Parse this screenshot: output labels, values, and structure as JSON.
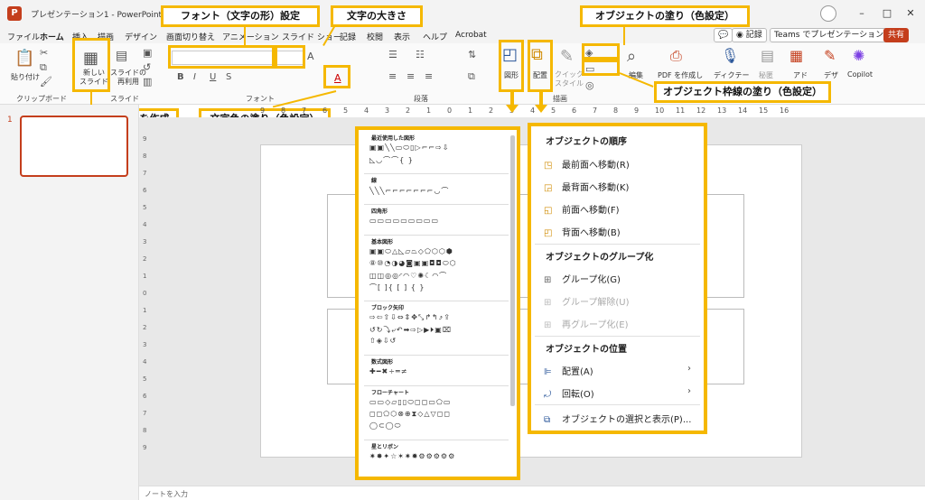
{
  "app": {
    "title": "プレゼンテーション1 - PowerPoint"
  },
  "window_controls": {
    "minimize": "–",
    "maximize": "□",
    "close": "✕"
  },
  "menu_tabs": [
    "ファイル",
    "ホーム",
    "挿入",
    "描画",
    "デザイン",
    "画面切り替え",
    "アニメーション",
    "スライド ショー",
    "記録",
    "校閲",
    "表示",
    "ヘルプ",
    "Acrobat"
  ],
  "ribbon_right": {
    "comment": "💬",
    "record": "◉ 記録",
    "teams": "Teams でプレゼンテーション",
    "share": "共有"
  },
  "ribbon": {
    "paste": "貼り付け",
    "new_slide": "新しい\nスライド",
    "reuse_slide": "スライドの\n再利用",
    "shapes": "図形",
    "arrange": "配置",
    "quick_styles": "クイック\nスタイル",
    "edit": "編集",
    "pdf": "PDF を作成し",
    "dictate": "ディクテー",
    "secret": "秘匿",
    "add": "アド",
    "design": "デザ",
    "copilot": "Copilot"
  },
  "groups": {
    "clipboard": "クリップボード",
    "slide": "スライド",
    "font": "フォント",
    "paragraph": "段落",
    "drawing": "描画"
  },
  "callouts": {
    "font": "フォント（文字の形）設定",
    "size": "文字の大きさ",
    "fill": "オブジェクトの塗り（色設定）",
    "outline": "オブジェクト枠線の塗り（色設定）",
    "new_page": "新しいページを作成",
    "text_color": "文字色の塗り（色設定）"
  },
  "ruler": [
    "9",
    "8",
    "7",
    "6",
    "5",
    "4",
    "3",
    "2",
    "1",
    "0",
    "1",
    "2",
    "3",
    "4",
    "5",
    "6",
    "7",
    "8",
    "9",
    "10",
    "11",
    "12",
    "13",
    "14",
    "15",
    "16"
  ],
  "vruler": [
    "9",
    "8",
    "7",
    "6",
    "5",
    "4",
    "3",
    "2",
    "1",
    "0",
    "1",
    "2",
    "3",
    "4",
    "5",
    "6",
    "7",
    "8",
    "9"
  ],
  "slide_number": "1",
  "notes": "ノートを入力",
  "shapes_panel": {
    "sections": [
      {
        "title": "最近使用した図形",
        "rows": [
          "▣▣╲╲▭⬭▯▷⌐⌐⇨⇩",
          "◺◡⌒⌒{ }"
        ]
      },
      {
        "title": "線",
        "rows": [
          "╲╲╲⌐⌐⌐⌐⌐⌐⌐◡⌒"
        ]
      },
      {
        "title": "四角形",
        "rows": [
          "▭▭▭▭▭▭▭▭▭"
        ]
      },
      {
        "title": "基本図形",
        "rows": [
          "▣▣⬭△◺▱⏢◇⬠⬡⬡⬢",
          "⑧⑩◔◑◕◙▣▣◘◘⬭⬡",
          "◫◫◎◎◜◠♡✺☾◠⌒",
          "⌒[ ]{ [ ] { }"
        ]
      },
      {
        "title": "ブロック矢印",
        "rows": [
          "⇨⇦⇧⇩⇔⇕✥⤡↱↰⤴⇪",
          "↺↻⤵⤶↶➡⇨▷▶⏵▣⌧",
          "⇧◈⇩↺"
        ]
      },
      {
        "title": "数式図形",
        "rows": [
          "✚━✖÷═≠"
        ]
      },
      {
        "title": "フローチャート",
        "rows": [
          "▭▭◇▱▯▯⬭◻◻▭⬠▭",
          "◻◻⬠⬡⊗⊕⧗◇△▽◻◻",
          "◯⊂◯⬭"
        ]
      },
      {
        "title": "星とリボン",
        "rows": [
          "✷✸✦☆✶✷✹⚙⚙⚙⚙⚙"
        ]
      }
    ]
  },
  "arrange_panel": {
    "order_title": "オブジェクトの順序",
    "order_items": [
      "最前面へ移動(R)",
      "最背面へ移動(K)",
      "前面へ移動(F)",
      "背面へ移動(B)"
    ],
    "group_title": "オブジェクトのグループ化",
    "group_items": [
      "グループ化(G)",
      "グループ解除(U)",
      "再グループ化(E)"
    ],
    "position_title": "オブジェクトの位置",
    "position_items": [
      "配置(A)",
      "回転(O)"
    ],
    "selection_pane": "オブジェクトの選択と表示(P)..."
  }
}
